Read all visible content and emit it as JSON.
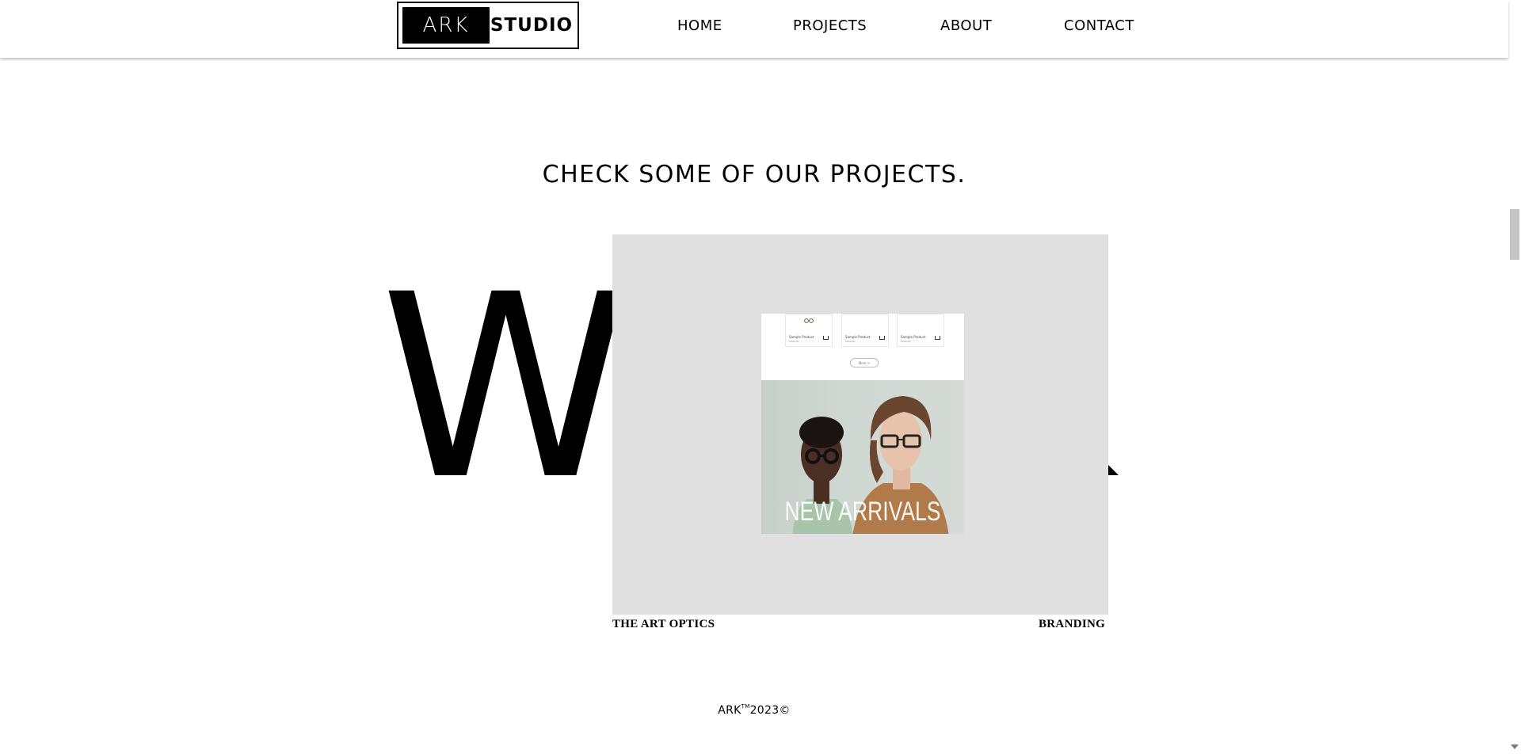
{
  "header": {
    "logo_left": "ARK",
    "logo_right": "STUDIO",
    "nav": [
      "HOME",
      "PROJECTS",
      "ABOUT",
      "CONTACT"
    ]
  },
  "section": {
    "title": "CHECK SOME OF OUR PROJECTS.",
    "big_letter": "W"
  },
  "project": {
    "preview": {
      "product_title": "Sample Product",
      "product_price": "$000.00",
      "more_button": "More >",
      "banner_text": "NEW ARRIVALS"
    },
    "name": "THE ART OPTICS",
    "category": "BRANDING"
  },
  "footer": {
    "brand": "ARK",
    "trademark": "TM",
    "year": "2023©"
  },
  "colors": {
    "card_bg": "#e0e0e0",
    "text": "#000000"
  },
  "icons": [
    "cart-icon",
    "chevron-down-icon"
  ]
}
